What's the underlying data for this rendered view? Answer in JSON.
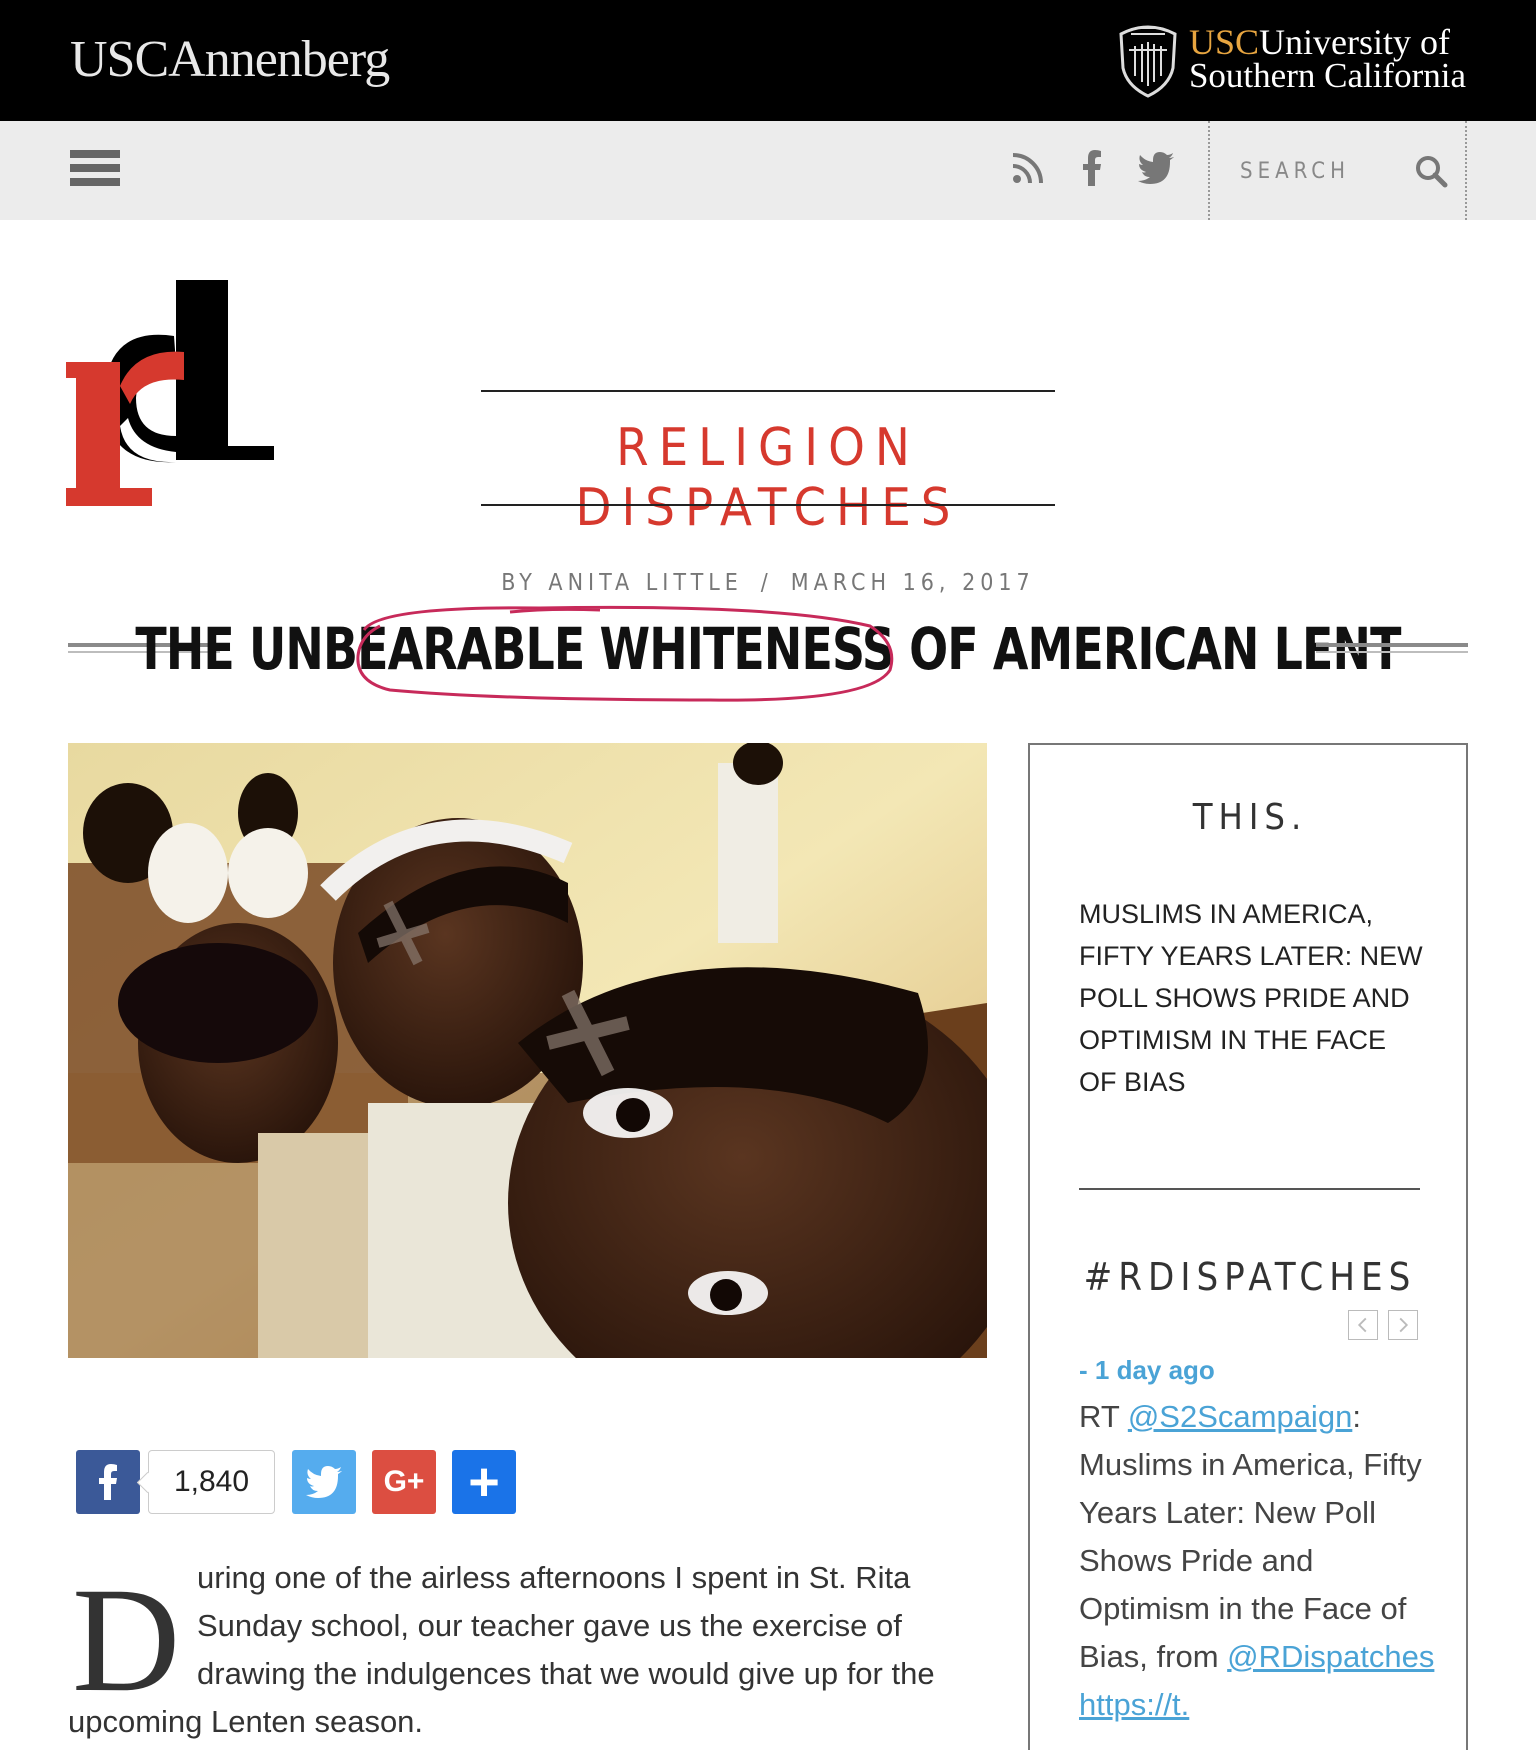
{
  "header": {
    "left_logo": "USCAnnenberg",
    "right_logo_line1_usc": "USC",
    "right_logo_line1_rest": "University of",
    "right_logo_line2": "Southern California"
  },
  "navbar": {
    "menu_icon": "hamburger-menu-icon",
    "social_icons": [
      "rss-icon",
      "facebook-icon",
      "twitter-icon"
    ],
    "search_placeholder": "SEARCH",
    "search_icon": "magnifier-icon"
  },
  "masthead": {
    "logo_text": "rd",
    "title": "RELIGION DISPATCHES",
    "accent_color": "#d6392e"
  },
  "article": {
    "byline_author": "BY ANITA LITTLE",
    "byline_separator": "/",
    "byline_date": "MARCH 16, 2017",
    "title": "THE UNBEARABLE WHITENESS OF AMERICAN LENT",
    "share": {
      "facebook_count": "1,840",
      "facebook_label": "f",
      "google_label": "G+",
      "add_label": "+"
    },
    "dropcap": "D",
    "body_lines": [
      "uring one of the airless afternoons I spent in St. Rita",
      "Sunday school, our teacher gave us the exercise of",
      "drawing the indulgences that we would give up for the",
      "upcoming Lenten season."
    ]
  },
  "sidebar": {
    "heading": "THIS.",
    "featured_story": "Muslims in America, Fifty Years Later: New Poll Shows Pride and Optimism in the Face of Bias",
    "hashtag_heading": "#RDISPATCHES",
    "tweet": {
      "time": "- 1 day ago",
      "rt": "RT ",
      "mention": "@S2Scampaign",
      "colon": ":",
      "text": "Muslims in America, Fifty Years Later: New Poll Shows Pride and Optimism in the Face of Bias, from",
      "handle": "@RDispatches",
      "link": "https://t."
    },
    "link_color": "#4aa3d6"
  }
}
